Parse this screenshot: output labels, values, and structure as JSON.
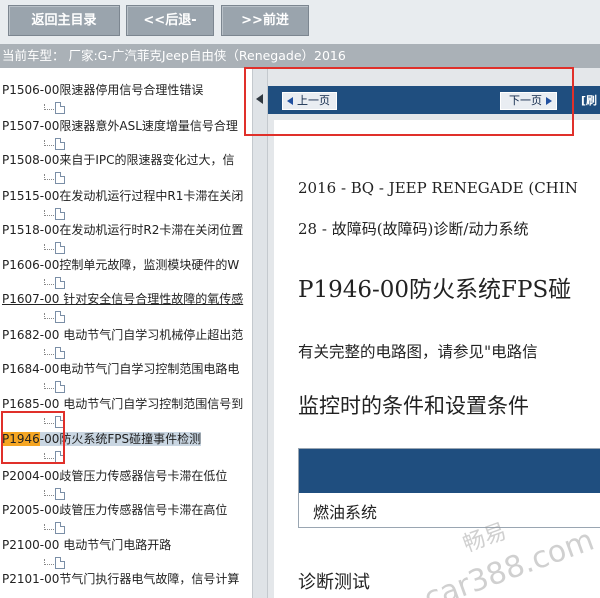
{
  "toolbar": {
    "home_label": "返回主目录",
    "back_label": "<<后退-",
    "forward_label": ">>前进"
  },
  "vehicle": {
    "text": "当前车型： 厂家:G-广汽菲克Jeep自由侠（Renegade）2016"
  },
  "tree": {
    "items": [
      {
        "label": "P1506-00限速器停用信号合理性错误"
      },
      {
        "label": "P1507-00限速器意外ASL速度增量信号合理"
      },
      {
        "label": "P1508-00来自于IPC的限速器变化过大，信"
      },
      {
        "label": "P1515-00在发动机运行过程中R1卡滞在关闭"
      },
      {
        "label": "P1518-00在发动机运行时R2卡滞在关闭位置"
      },
      {
        "label": "P1606-00控制单元故障，监测模块硬件的W"
      },
      {
        "label": "P1607-00 针对安全信号合理性故障的氧传感"
      },
      {
        "label": "P1682-00 电动节气门自学习机械停止超出范"
      },
      {
        "label": "P1684-00电动节气门自学习控制范围电路电"
      },
      {
        "label": "P1685-00 电动节气门自学习控制范围信号到"
      },
      {
        "label_hl": "P1946",
        "label_rest": "-00防火系统FPS碰撞事件检测"
      },
      {
        "label": "P2004-00歧管压力传感器信号卡滞在低位"
      },
      {
        "label": "P2005-00歧管压力传感器信号卡滞在高位"
      },
      {
        "label": "P2100-00 电动节气门电路开路"
      },
      {
        "label": "P2101-00节气门执行器电气故障，信号计算"
      }
    ]
  },
  "content": {
    "prev_label": "上一页",
    "next_label": "下一页",
    "nav_extra": "[刷",
    "breadcrumb1": "2016 - BQ - JEEP RENEGADE (CHIN",
    "breadcrumb2": "28 - 故障码(故障码)诊断/动力系统",
    "title": "P1946-00防火系统FPS碰",
    "note": "有关完整的电路图，请参见\"电路信",
    "section_heading": "监控时的条件和设置条件",
    "table_cell": "燃油系统",
    "next_heading": "诊断测试"
  },
  "watermark": {
    "line1": "畅易",
    "line2": "car388.com"
  },
  "colors": {
    "toolbar_button": "#9aa4ad",
    "nav_blue": "#1f4e7f",
    "highlight_orange": "#f5a623",
    "annotation_red": "#e0302a"
  }
}
